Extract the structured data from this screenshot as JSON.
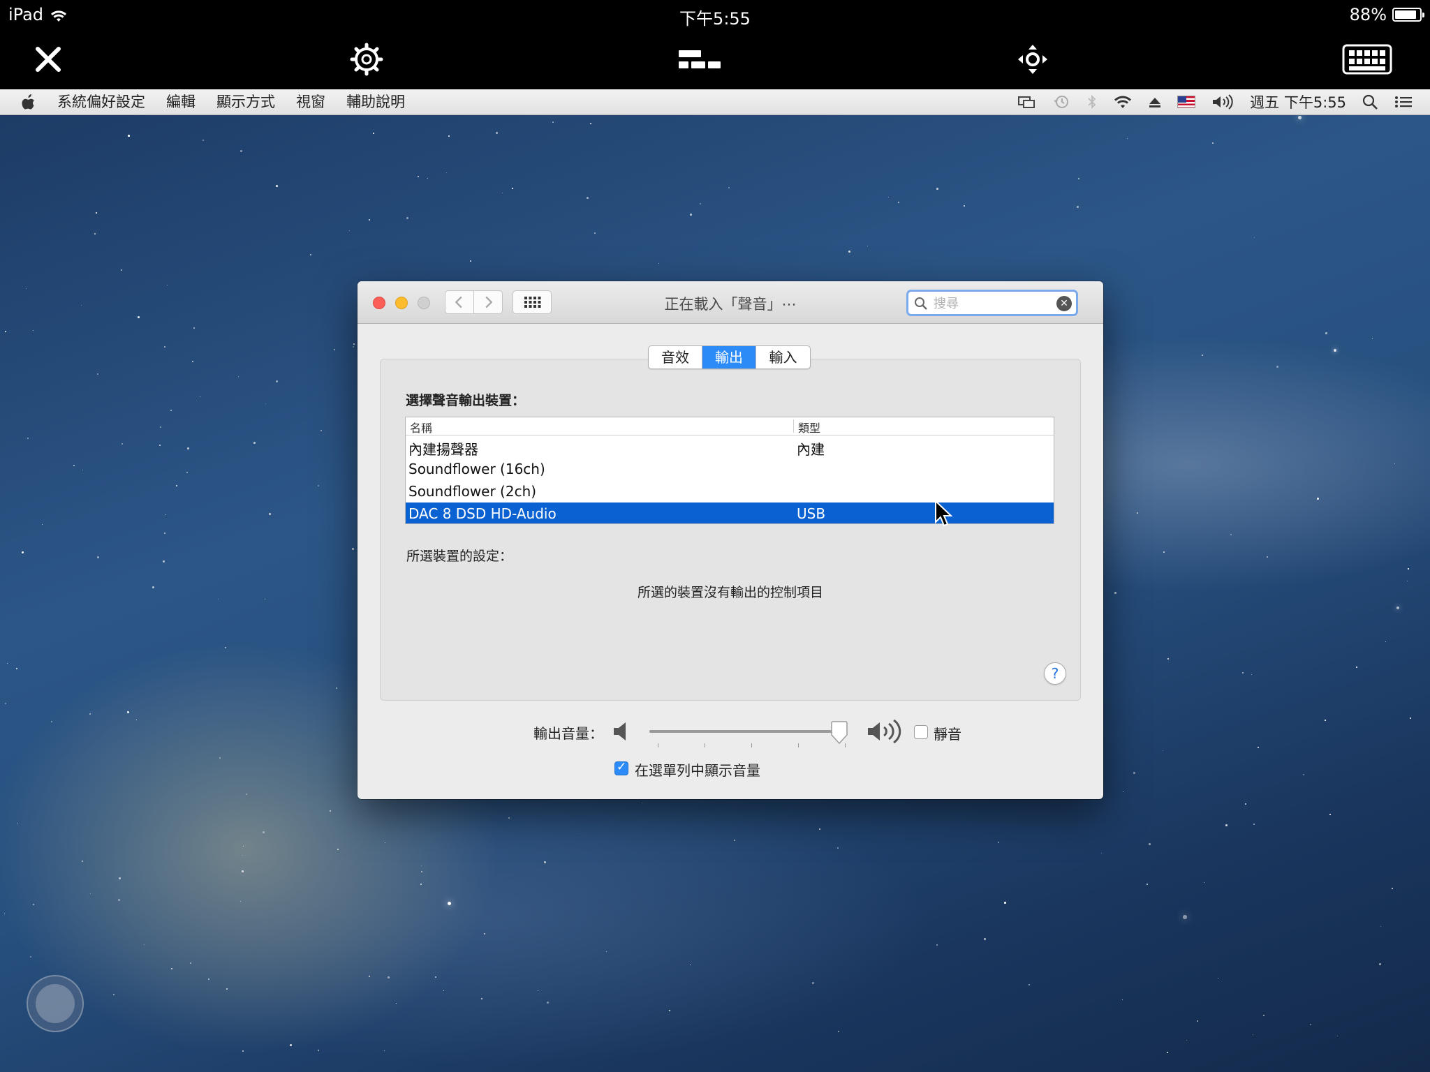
{
  "ios_status": {
    "device": "iPad",
    "time": "下午5:55",
    "battery": "88%",
    "battery_level": 0.88
  },
  "toolbar": {
    "icons": [
      "close-icon",
      "gear-icon",
      "layout-icon",
      "move-icon",
      "keyboard-icon"
    ]
  },
  "menubar": {
    "app_menus": [
      "系統偏好設定",
      "編輯",
      "顯示方式",
      "視窗",
      "輔助說明"
    ],
    "clock": "週五 下午5:55",
    "extras_icons": [
      "display-mirroring-icon",
      "time-machine-icon",
      "bluetooth-icon",
      "wifi-icon",
      "eject-icon",
      "us-flag-icon",
      "volume-icon",
      "spotlight-icon",
      "notification-list-icon"
    ]
  },
  "window": {
    "title": "正在載入「聲音」⋯",
    "search_placeholder": "搜尋",
    "tabs": [
      {
        "label": "音效",
        "active": false
      },
      {
        "label": "輸出",
        "active": true
      },
      {
        "label": "輸入",
        "active": false
      }
    ],
    "choose_label": "選擇聲音輸出裝置：",
    "table": {
      "col_name": "名稱",
      "col_type": "類型",
      "rows": [
        {
          "name": "內建揚聲器",
          "type": "內建",
          "selected": false
        },
        {
          "name": "Soundflower (16ch)",
          "type": "",
          "selected": false
        },
        {
          "name": "Soundflower (2ch)",
          "type": "",
          "selected": false
        },
        {
          "name": "DAC 8 DSD HD-Audio",
          "type": "USB",
          "selected": true
        }
      ]
    },
    "settings_label": "所選裝置的設定：",
    "no_controls": "所選的裝置沒有輸出的控制項目",
    "help": "?",
    "volume_label": "輸出音量：",
    "volume_level": 0.97,
    "mute_label": "靜音",
    "mute_checked": false,
    "show_volume_label": "在選單列中顯示音量",
    "show_volume_checked": true
  },
  "colors": {
    "selection": "#0a62d2",
    "tab_active": "#2d8bf7",
    "close": "#fc5f57",
    "minimize": "#fdbc2e",
    "zoom_disabled": "#d0d0d0"
  }
}
